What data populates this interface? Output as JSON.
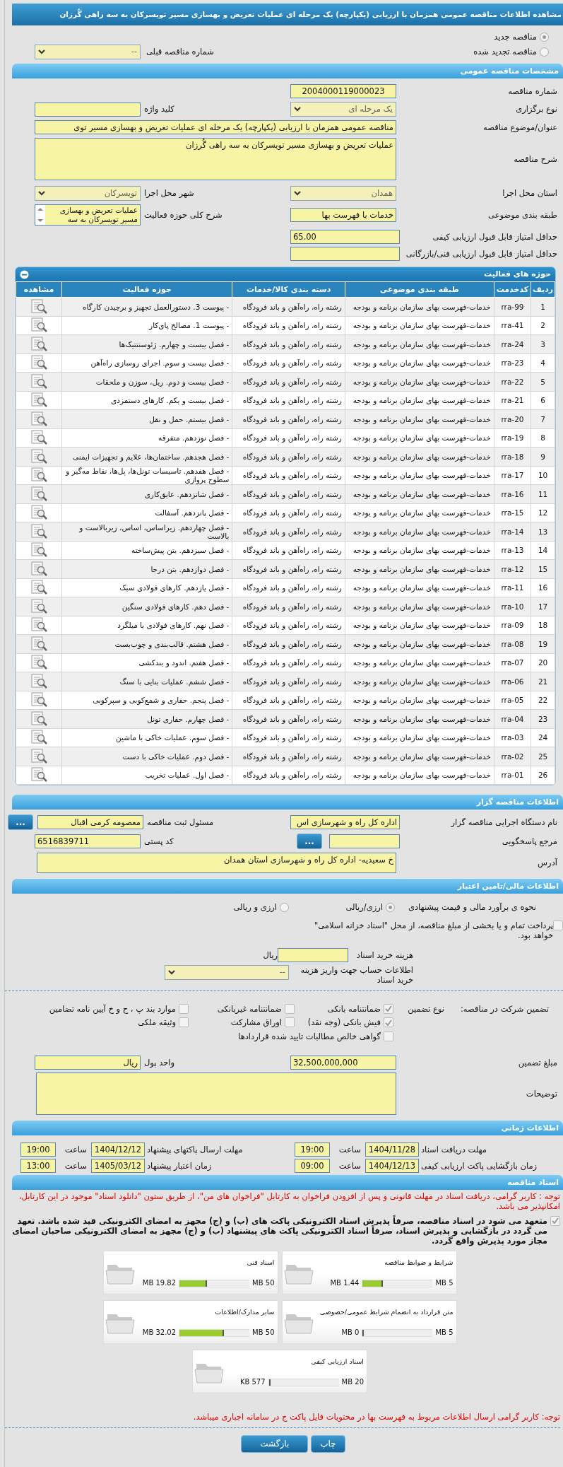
{
  "title": "مشاهده اطلاعات مناقصه عمومی همزمان با ارزیابی (یکپارچه) یک مرحله ای عملیات تعریض و بهسازی مسیر تویسرکان به سه راهی گُرزان",
  "tender_kind": [
    {
      "label": "مناقصه جدید",
      "selected": true
    },
    {
      "label": "مناقصه تجدید شده",
      "selected": false
    }
  ],
  "previous_number": {
    "label": "شماره مناقصه قبلی",
    "value": "--"
  },
  "general": {
    "header": "مشخصات مناقصه عمومی",
    "number": {
      "label": "شماره مناقصه",
      "value": "2004000119000023"
    },
    "holding_type": {
      "label": "نوع برگزاری",
      "value": "یک مرحله ای"
    },
    "keyword": {
      "label": "کلید واژه"
    },
    "subject": {
      "label": "عنوان/موضوع مناقصه",
      "value": "مناقصه عمومی همزمان با ارزیابی (یکپارچه) یک مرحله ای عملیات تعریض و بهسازی مسیر توی"
    },
    "description": {
      "label": "شرح مناقصه",
      "value": "عملیات تعریض و بهسازی مسیر تویسرکان به سه راهی گُرزان"
    },
    "province": {
      "label": "استان محل اجرا",
      "value": "همدان"
    },
    "city": {
      "label": "شهر محل اجرا",
      "value": "تویسرکان"
    },
    "category": {
      "label": "طبقه بندی موضوعی",
      "value": "خدمات با فهرست بها"
    },
    "activity_scope": {
      "label": "شرح کلی حوزه فعالیت",
      "value": "عملیات تعریض و بهسازی مسیر تویسرکان به سه"
    },
    "min_quality_score": {
      "label": "حداقل امتیاز قابل قبول ارزیابی کیفی",
      "value": "65.00"
    },
    "min_technical_score": {
      "label": "حداقل امتیاز قابل قبول ارزیابی فنی/بازرگانی"
    }
  },
  "activities": {
    "header": "حوزه های فعالیت",
    "columns": [
      "ردیف",
      "کدخدمت",
      "طبقه بندی موضوعی",
      "دسته بندی کالا/خدمات",
      "حوزه فعالیت",
      "مشاهده"
    ],
    "rows": [
      {
        "index": "1",
        "code": "rra-99",
        "category": "خدمات-فهرست بهای سازمان برنامه و بودجه",
        "group": "رشته راه، راه‌آهن و باند فرودگاه",
        "activity": "- پیوست 3. دستورالعمل تجهیز و برچیدن کارگاه"
      },
      {
        "index": "2",
        "code": "rra-41",
        "category": "خدمات-فهرست بهای سازمان برنامه و بودجه",
        "group": "رشته راه، راه‌آهن و باند فرودگاه",
        "activity": "- پیوست 1. مصالح پای‌کار"
      },
      {
        "index": "3",
        "code": "rra-24",
        "category": "خدمات-فهرست بهای سازمان برنامه و بودجه",
        "group": "رشته راه، راه‌آهن و باند فرودگاه",
        "activity": "- فصل بیست و چهارم. ژئوسنتتیک‌ها"
      },
      {
        "index": "4",
        "code": "rra-23",
        "category": "خدمات-فهرست بهای سازمان برنامه و بودجه",
        "group": "رشته راه، راه‌آهن و باند فرودگاه",
        "activity": "- فصل بیست و سوم. اجرای روسازی راه‌آهن"
      },
      {
        "index": "5",
        "code": "rra-22",
        "category": "خدمات-فهرست بهای سازمان برنامه و بودجه",
        "group": "رشته راه، راه‌آهن و باند فرودگاه",
        "activity": "- فصل بیست و دوم. ریل، سوزن و ملحقات"
      },
      {
        "index": "6",
        "code": "rra-21",
        "category": "خدمات-فهرست بهای سازمان برنامه و بودجه",
        "group": "رشته راه، راه‌آهن و باند فرودگاه",
        "activity": "- فصل بیست و یکم. کارهای دستمزدی"
      },
      {
        "index": "7",
        "code": "rra-20",
        "category": "خدمات-فهرست بهای سازمان برنامه و بودجه",
        "group": "رشته راه، راه‌آهن و باند فرودگاه",
        "activity": "- فصل بیستم. حمل و نقل"
      },
      {
        "index": "8",
        "code": "rra-19",
        "category": "خدمات-فهرست بهای سازمان برنامه و بودجه",
        "group": "رشته راه، راه‌آهن و باند فرودگاه",
        "activity": "- فصل نوزدهم. متفرقه"
      },
      {
        "index": "9",
        "code": "rra-18",
        "category": "خدمات-فهرست بهای سازمان برنامه و بودجه",
        "group": "رشته راه، راه‌آهن و باند فرودگاه",
        "activity": "- فصل هجدهم. ساختمان‌ها، علایم و تجهیزات ایمنی"
      },
      {
        "index": "10",
        "code": "rra-17",
        "category": "خدمات-فهرست بهای سازمان برنامه و بودجه",
        "group": "رشته راه، راه‌آهن و باند فرودگاه",
        "activity": "- فصل هفدهم. تاسیسات تونل‌ها، پل‌ها، نقاط مه‌گیر و سطوح پروازی"
      },
      {
        "index": "11",
        "code": "rra-16",
        "category": "خدمات-فهرست بهای سازمان برنامه و بودجه",
        "group": "رشته راه، راه‌آهن و باند فرودگاه",
        "activity": "- فصل شانزدهم. عایق‌کاری"
      },
      {
        "index": "12",
        "code": "rra-15",
        "category": "خدمات-فهرست بهای سازمان برنامه و بودجه",
        "group": "رشته راه، راه‌آهن و باند فرودگاه",
        "activity": "- فصل پانزدهم. آسفالت"
      },
      {
        "index": "13",
        "code": "rra-14",
        "category": "خدمات-فهرست بهای سازمان برنامه و بودجه",
        "group": "رشته راه، راه‌آهن و باند فرودگاه",
        "activity": "- فصل چهاردهم. زیراساس، اساس، زیربالاست و بالاست"
      },
      {
        "index": "14",
        "code": "rra-13",
        "category": "خدمات-فهرست بهای سازمان برنامه و بودجه",
        "group": "رشته راه، راه‌آهن و باند فرودگاه",
        "activity": "- فصل سیزدهم. بتن پیش‌ساخته"
      },
      {
        "index": "15",
        "code": "rra-12",
        "category": "خدمات-فهرست بهای سازمان برنامه و بودجه",
        "group": "رشته راه، راه‌آهن و باند فرودگاه",
        "activity": "- فصل دوازدهم. بتن درجا"
      },
      {
        "index": "16",
        "code": "rra-11",
        "category": "خدمات-فهرست بهای سازمان برنامه و بودجه",
        "group": "رشته راه، راه‌آهن و باند فرودگاه",
        "activity": "- فصل یازدهم. کارهای فولادی سبک"
      },
      {
        "index": "17",
        "code": "rra-10",
        "category": "خدمات-فهرست بهای سازمان برنامه و بودجه",
        "group": "رشته راه، راه‌آهن و باند فرودگاه",
        "activity": "- فصل دهم. کارهای فولادی سنگین"
      },
      {
        "index": "18",
        "code": "rra-09",
        "category": "خدمات-فهرست بهای سازمان برنامه و بودجه",
        "group": "رشته راه، راه‌آهن و باند فرودگاه",
        "activity": "- فصل نهم. کارهای فولادی با میلگرد"
      },
      {
        "index": "19",
        "code": "rra-08",
        "category": "خدمات-فهرست بهای سازمان برنامه و بودجه",
        "group": "رشته راه، راه‌آهن و باند فرودگاه",
        "activity": "- فصل هشتم. قالب‌بندی و چوب‌بست"
      },
      {
        "index": "20",
        "code": "rra-07",
        "category": "خدمات-فهرست بهای سازمان برنامه و بودجه",
        "group": "رشته راه، راه‌آهن و باند فرودگاه",
        "activity": "- فصل هفتم. اندود و بندکشی"
      },
      {
        "index": "21",
        "code": "rra-06",
        "category": "خدمات-فهرست بهای سازمان برنامه و بودجه",
        "group": "رشته راه، راه‌آهن و باند فرودگاه",
        "activity": "- فصل ششم. عملیات بنایی با سنگ"
      },
      {
        "index": "22",
        "code": "rra-05",
        "category": "خدمات-فهرست بهای سازمان برنامه و بودجه",
        "group": "رشته راه، راه‌آهن و باند فرودگاه",
        "activity": "- فصل پنجم. حفاری و شمع‌کوبی و سپرکوبی"
      },
      {
        "index": "23",
        "code": "rra-04",
        "category": "خدمات-فهرست بهای سازمان برنامه و بودجه",
        "group": "رشته راه، راه‌آهن و باند فرودگاه",
        "activity": "- فصل چهارم. حفاری تونل"
      },
      {
        "index": "24",
        "code": "rra-03",
        "category": "خدمات-فهرست بهای سازمان برنامه و بودجه",
        "group": "رشته راه، راه‌آهن و باند فرودگاه",
        "activity": "- فصل سوم. عملیات خاکی با ماشین"
      },
      {
        "index": "25",
        "code": "rra-02",
        "category": "خدمات-فهرست بهای سازمان برنامه و بودجه",
        "group": "رشته راه، راه‌آهن و باند فرودگاه",
        "activity": "- فصل دوم. عملیات خاکی با دست"
      },
      {
        "index": "26",
        "code": "rra-01",
        "category": "خدمات-فهرست بهای سازمان برنامه و بودجه",
        "group": "رشته راه، راه‌آهن و باند فرودگاه",
        "activity": "- فصل اول. عملیات تخریب"
      }
    ]
  },
  "organizer": {
    "header": "اطلاعات مناقصه گزار",
    "agency": {
      "label": "نام دستگاه اجرایی مناقصه گزار",
      "value": "اداره کل راه و شهرسازی اس"
    },
    "registrar": {
      "label": "مسئول ثبت مناقصه",
      "value": "معصومه کرمی اقبال",
      "button": "..."
    },
    "reference": {
      "label": "مرجع پاسخگویی",
      "button": "..."
    },
    "postal_code": {
      "label": "کد پستی",
      "value": "6516839711"
    },
    "address": {
      "label": "آدرس",
      "value": "خ سعیدیه- اداره کل راه و شهرسازی استان همدان"
    }
  },
  "finance": {
    "header": "اطلاعات مالی/تامین اعتبار",
    "estimate": {
      "label": "نحوه ی برآورد مالی و قیمت پیشنهادی",
      "options": [
        {
          "label": "ارزی/ریالی",
          "selected": true
        },
        {
          "label": "ارزی و ریالی",
          "selected": false
        }
      ]
    },
    "treasury": {
      "label": "پرداخت تمام و یا بخشی از مبلغ مناقصه، از محل \"اسناد خزانه اسلامی\" خواهد بود.",
      "checked": false
    },
    "document_fee": {
      "label": "هزینه خرید اسناد",
      "unit": "ریال"
    },
    "account": {
      "label": "اطلاعات حساب جهت واریز هزینه خرید اسناد",
      "value": "--"
    }
  },
  "guarantee": {
    "label": "تضمین شرکت در مناقصه:",
    "type_label": "نوع تضمین",
    "options": [
      {
        "label": "ضمانتنامه بانکی",
        "checked": true
      },
      {
        "label": "ضمانتنامه غیربانکی",
        "checked": false
      },
      {
        "label": "موارد بند پ ، ح و خ آیین نامه تضامین",
        "checked": false
      },
      {
        "label": "فیش بانکی (وجه نقد)",
        "checked": true
      },
      {
        "label": "اوراق مشارکت",
        "checked": false
      },
      {
        "label": "وثیقه ملکی",
        "checked": false
      },
      {
        "label": "گواهی خالص مطالبات تایید شده قراردادها",
        "checked": false
      }
    ],
    "amount": {
      "label": "مبلغ تضمین",
      "value": "32,500,000,000"
    },
    "currency": {
      "label": "واحد پول",
      "value": "ریال"
    },
    "notes": {
      "label": "توضیحات"
    }
  },
  "schedule": {
    "header": "اطلاعات زمانی",
    "items": [
      {
        "label": "مهلت دریافت اسناد",
        "date": "1404/11/28",
        "time_label": "ساعت",
        "time": "19:00"
      },
      {
        "label": "مهلت ارسال پاکتهای پیشنهاد",
        "date": "1404/12/12",
        "time_label": "ساعت",
        "time": "19:00"
      },
      {
        "label": "زمان بازگشایی پاکت ارزیابی کیفی",
        "date": "1404/12/13",
        "time_label": "ساعت",
        "time": "09:00"
      },
      {
        "label": "زمان اعتبار پیشنهاد",
        "date": "1405/03/12",
        "time_label": "ساعت",
        "time": "13:00"
      }
    ]
  },
  "documents": {
    "header": "اسناد مناقصه",
    "notice": "توجه : کاربر گرامی، دریافت اسناد در مهلت قانونی و پس از افزودن فراخوان به کارتابل \"فراخوان های من\"، از طریق ستون \"دانلود اسناد\" موجود در این کارتابل، امکانپذیر می باشد.",
    "commitment": {
      "checked": true,
      "text": "متعهد می شود در اسناد مناقصه، صرفاً پذیرش اسناد الکترونیکی پاکت های (ب) و (ج) مجهز به امضای الکترونیکی قید شده باشد. تعهد می گردد در بازگشایی و پذیرش اسناد، صرفاً اسناد الکترونیکی پاکت های پیشنهاد (ب) و (ج) مجهز به امضای الکترونیکی صاحبان امضای مجاز مورد پذیرش واقع گردد."
    },
    "files": [
      {
        "title": "شرایط و ضوابط مناقصه",
        "used": "1.44 MB",
        "max": "5 MB",
        "level": 0.288
      },
      {
        "title": "اسناد فنی",
        "used": "19.82 MB",
        "max": "50 MB",
        "level": 0.396
      },
      {
        "title": "متن قرارداد به انضمام شرایط عمومی/خصوصی",
        "used": "0 MB",
        "max": "5 MB",
        "level": 0
      },
      {
        "title": "سایر مدارک/اطلاعات",
        "used": "32.02 MB",
        "max": "50 MB",
        "level": 0.64
      },
      {
        "title": "اسناد ارزیابی کیفی",
        "used": "577 KB",
        "max": "20 MB",
        "level": 0.028
      }
    ],
    "footer_note": "توجه: کاربر گرامی ارسال اطلاعات مربوط به فهرست بها در محتویات فایل پاکت ج در سامانه اجباری میباشد."
  },
  "buttons": [
    "چاپ",
    "بازگشت"
  ]
}
